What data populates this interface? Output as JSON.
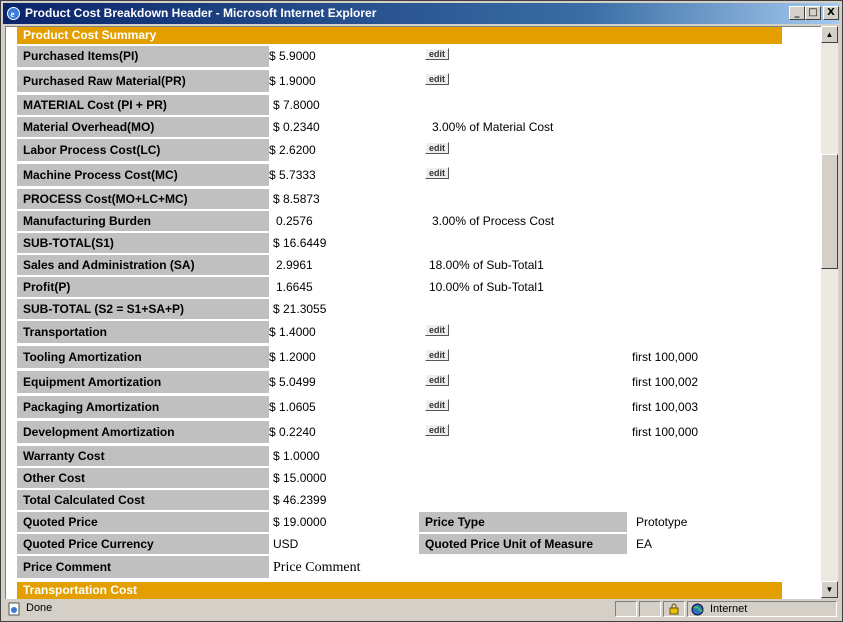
{
  "window": {
    "title": "Product Cost Breakdown Header - Microsoft Internet Explorer",
    "minimize": "_",
    "maximize": "□",
    "close": "X"
  },
  "sections": {
    "summary_title": "Product Cost Summary",
    "transport_title": "Transportation Cost"
  },
  "edit_label": "edit",
  "rows": [
    {
      "label": "Purchased Items(PI)",
      "value": "$ 5.9000",
      "note": "",
      "extra": ""
    },
    {
      "label": "Purchased Raw Material(PR)",
      "value": "$ 1.9000",
      "note": "",
      "extra": ""
    },
    {
      "label": "MATERIAL Cost (PI + PR)",
      "value": "$ 7.8000",
      "note": "",
      "extra": ""
    },
    {
      "label": "Material Overhead(MO)",
      "value": "$ 0.2340",
      "note": "3.00% of Material Cost",
      "extra": ""
    },
    {
      "label": "Labor Process Cost(LC)",
      "value": "$ 2.6200",
      "note": "",
      "extra": ""
    },
    {
      "label": "Machine Process Cost(MC)",
      "value": "$ 5.7333",
      "note": "",
      "extra": ""
    },
    {
      "label": "PROCESS Cost(MO+LC+MC)",
      "value": "$ 8.5873",
      "note": "",
      "extra": ""
    },
    {
      "label": "Manufacturing Burden",
      "value": "0.2576",
      "note": "3.00% of Process Cost",
      "extra": ""
    },
    {
      "label": "SUB-TOTAL(S1)",
      "value": "$ 16.6449",
      "note": "",
      "extra": ""
    },
    {
      "label": "Sales and Administration (SA)",
      "value": "2.9961",
      "note": "18.00% of Sub-Total1",
      "extra": ""
    },
    {
      "label": "Profit(P)",
      "value": "1.6645",
      "note": "10.00% of Sub-Total1",
      "extra": ""
    },
    {
      "label": "SUB-TOTAL (S2 = S1+SA+P)",
      "value": "$ 21.3055",
      "note": "",
      "extra": ""
    },
    {
      "label": "Transportation",
      "value": "$ 1.4000",
      "note": "",
      "extra": ""
    },
    {
      "label": "Tooling Amortization",
      "value": "$ 1.2000",
      "note": "",
      "extra": "first 100,000"
    },
    {
      "label": "Equipment Amortization",
      "value": "$ 5.0499",
      "note": "",
      "extra": "first 100,002"
    },
    {
      "label": "Packaging Amortization",
      "value": "$ 1.0605",
      "note": "",
      "extra": "first 100,003"
    },
    {
      "label": "Development Amortization",
      "value": "$ 0.2240",
      "note": "",
      "extra": "first 100,000"
    },
    {
      "label": "Warranty Cost",
      "value": "$ 1.0000",
      "note": "",
      "extra": ""
    },
    {
      "label": "Other Cost",
      "value": "$ 15.0000",
      "note": "",
      "extra": ""
    },
    {
      "label": "Total Calculated Cost",
      "value": "$ 46.2399",
      "note": "",
      "extra": ""
    },
    {
      "label": "Quoted Price",
      "value": "$ 19.0000",
      "note": "",
      "extra": ""
    },
    {
      "label": "Quoted Price Currency",
      "value": "USD",
      "note": "",
      "extra": ""
    },
    {
      "label": "Price Comment",
      "value": "Price Comment",
      "note": "",
      "extra": ""
    }
  ],
  "side_fields": [
    {
      "label": "Price Type",
      "value": "Prototype"
    },
    {
      "label": "Quoted Price Unit of Measure",
      "value": "EA"
    }
  ],
  "status": {
    "text": "Done",
    "zone": "Internet"
  }
}
